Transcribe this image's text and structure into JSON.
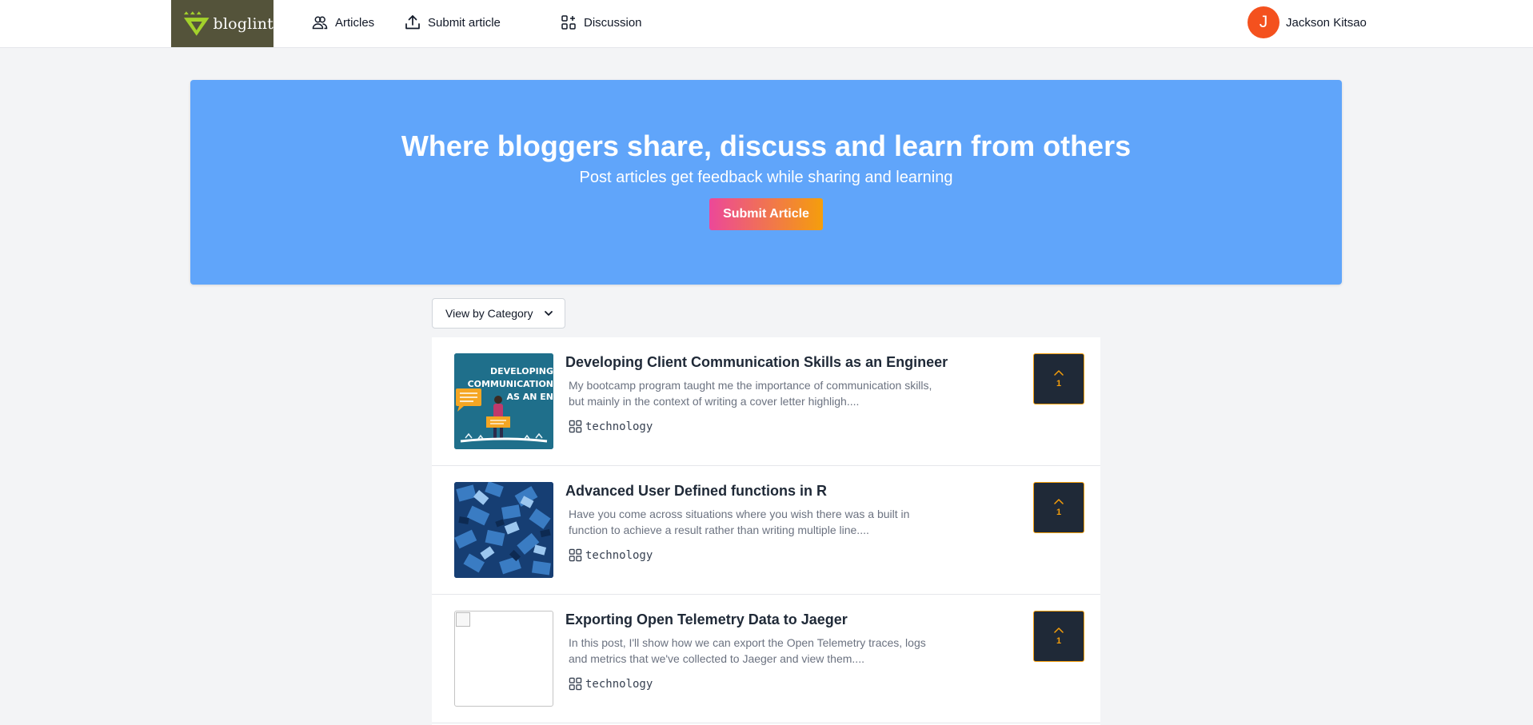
{
  "brand": {
    "name": "bloglint",
    "bg_color": "#54533a",
    "accent_color": "#a3d12b"
  },
  "nav": {
    "items": [
      {
        "label": "Articles",
        "icon": "users-icon"
      },
      {
        "label": "Submit article",
        "icon": "upload-icon"
      },
      {
        "label": "Discussion",
        "icon": "grid-plus-icon"
      }
    ],
    "user": {
      "initial": "J",
      "name": "Jackson Kitsao",
      "avatar_color": "#f4511e"
    }
  },
  "hero": {
    "title": "Where bloggers share, discuss and learn from others",
    "subtitle": "Post articles get feedback while sharing and learning",
    "button_label": "Submit Article",
    "bg_color": "#60a5fa"
  },
  "filter": {
    "label": "View by Category",
    "icon": "chevron-down-icon"
  },
  "articles": [
    {
      "title": "Developing Client Communication Skills as an Engineer",
      "excerpt": "My bootcamp program taught me the importance of communication skills, but mainly in the context of writing a cover letter highligh....",
      "category": "technology",
      "votes": "1",
      "thumbnail": {
        "kind": "illustration",
        "bg_color": "#1f6f8b",
        "lines": [
          "DEVELOPING",
          "COMMUNICATION",
          "AS AN EN"
        ]
      }
    },
    {
      "title": "Advanced User Defined functions in R",
      "excerpt": "Have you come across situations where you wish there was a built in function to achieve a result rather than writing multiple line....",
      "category": "technology",
      "votes": "1",
      "thumbnail": {
        "kind": "photo-blue-blocks",
        "bg_color": "#1e4d8c"
      }
    },
    {
      "title": "Exporting Open Telemetry Data to Jaeger",
      "excerpt": "In this post, I'll show how we can export the Open Telemetry traces, logs and metrics that we've collected to Jaeger and view them....",
      "category": "technology",
      "votes": "1",
      "thumbnail": {
        "kind": "broken-image"
      }
    }
  ],
  "colors": {
    "vote_bg": "#1f2937",
    "vote_accent": "#f59e0b",
    "page_bg": "#f3f4f6"
  }
}
